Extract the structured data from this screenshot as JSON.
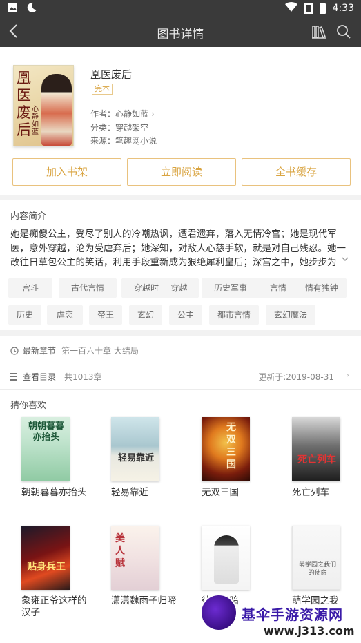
{
  "status": {
    "time": "4:33"
  },
  "appbar": {
    "title": "图书详情"
  },
  "book": {
    "title": "凰医废后",
    "status": "完本",
    "author": "作者：心静如蓝",
    "category": "分类：穿越架空",
    "source": "来源：笔趣网小说",
    "cover_title": "凰医废后",
    "cover_author": "心静如蓝"
  },
  "actions": {
    "add_shelf": "加入书架",
    "read_now": "立即阅读",
    "cache_all": "全书缓存"
  },
  "intro": {
    "heading": "内容简介",
    "text": "她是痴傻公主，受尽了别人的冷嘲热讽，遭君遗弃，落入无情冷宫；她是现代军医，意外穿越，沦为受虐弃后；她深知，对敌人心慈手软，就是对自己残忍。她一改往日草包公主的笑话，利用手段重新成为狠绝犀利皇后；深宫之中，她步步为"
  },
  "tags": [
    "宫斗",
    "古代言情",
    "穿越时空",
    "穿越",
    "历史军事",
    "言情",
    "情有独钟",
    "历史",
    "虐恋",
    "帝王",
    "玄幻",
    "公主",
    "都市言情",
    "玄幻魔法"
  ],
  "latest": {
    "label": "最新章节",
    "value": "第一百六十章 大结局"
  },
  "toc": {
    "label": "查看目录",
    "count": "共1013章",
    "updated": "更新于:2019-08-31"
  },
  "guess": {
    "heading": "猜你喜欢",
    "books": [
      {
        "name": "朝朝暮暮亦抬头",
        "cover_text": "朝朝暮暮亦抬头"
      },
      {
        "name": "轻易靠近",
        "cover_text": "轻易靠近"
      },
      {
        "name": "无双三国",
        "cover_text": "无双三国"
      },
      {
        "name": "死亡列车",
        "cover_text": "死亡列车"
      },
      {
        "name": "象雍正爷这样的汉子",
        "cover_text": "贴身兵王"
      },
      {
        "name": "潇潇魏雨子归啼",
        "cover_text": "美人赋"
      },
      {
        "name": "待嫁黑暗",
        "cover_text": ""
      },
      {
        "name": "萌学园之我",
        "cover_text": "萌学园之我们的使命"
      }
    ]
  },
  "watermark": {
    "line1": "基伞手游资源网",
    "line2": "www.j313.com"
  },
  "colors": {
    "accent": "#d9a441",
    "bar": "#3a3a3a"
  }
}
